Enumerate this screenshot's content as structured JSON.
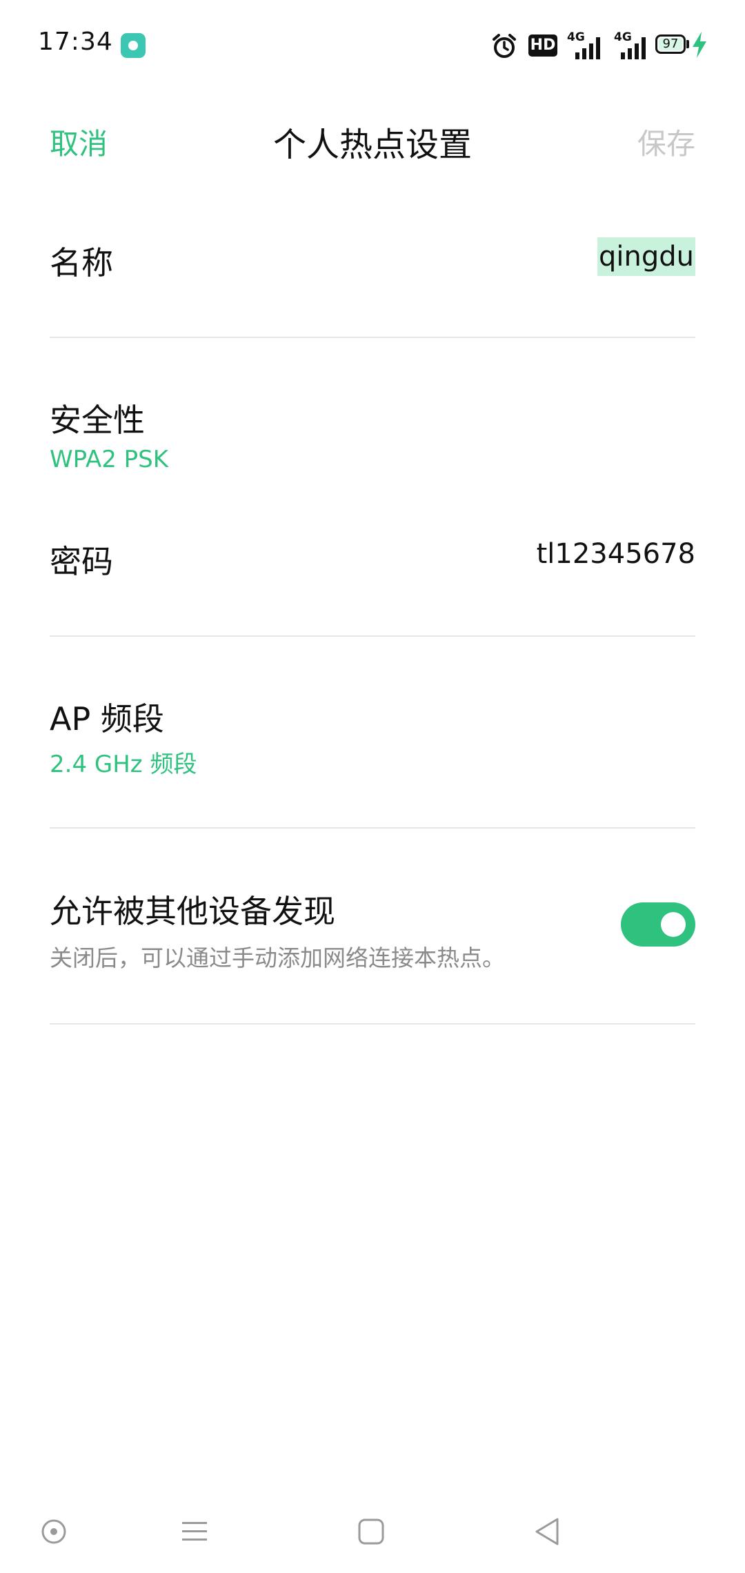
{
  "status_bar": {
    "time": "17:34",
    "battery": "97",
    "network_1": "4G",
    "network_2": "4G",
    "hd_label": "HD",
    "icons": [
      "app-icon",
      "alarm-icon",
      "hd-icon",
      "signal-icon",
      "signal-icon",
      "battery-icon",
      "charging-icon"
    ]
  },
  "header": {
    "cancel": "取消",
    "title": "个人热点设置",
    "save": "保存"
  },
  "rows": {
    "name": {
      "label": "名称",
      "value": "qingdu"
    },
    "security": {
      "label": "安全性",
      "value": "WPA2 PSK"
    },
    "password": {
      "label": "密码",
      "value": "tl12345678"
    },
    "band": {
      "label": "AP 频段",
      "value": "2.4 GHz 频段"
    },
    "discoverable": {
      "label": "允许被其他设备发现",
      "description": "关闭后，可以通过手动添加网络连接本热点。",
      "enabled": true
    }
  },
  "colors": {
    "accent": "#2fc27f",
    "name_highlight": "#c9f2dc",
    "disabled": "#c8c8c8",
    "divider": "#e6e6e6",
    "secondary_text": "#8a8a8a"
  },
  "nav_bar": {
    "icons": [
      "screen-record-icon",
      "menu-icon",
      "home-icon",
      "back-icon"
    ]
  }
}
